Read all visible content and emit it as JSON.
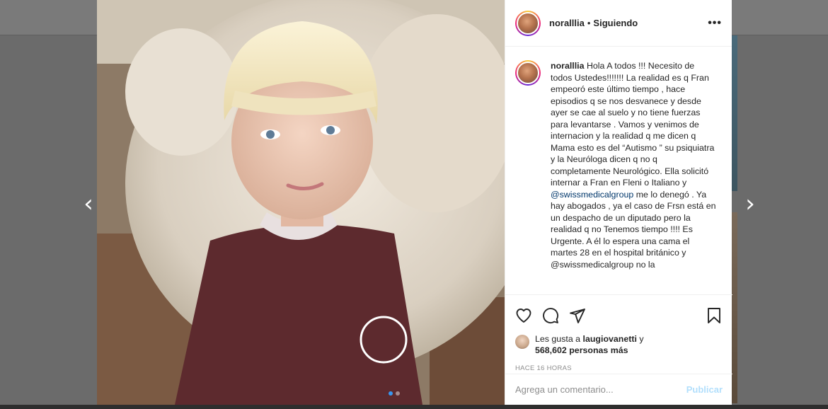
{
  "post": {
    "username": "noralllia",
    "separator": "•",
    "follow_status": "Siguiendo",
    "more_label": "•••",
    "caption_user": "noralllia",
    "caption_part1": "Hola A todos !!! Necesito de todos Ustedes!!!!!!! La realidad es q Fran empeoró este último tiempo , hace episodios q se nos desvanece y desde ayer se cae al suelo y no tiene fuerzas para levantarse . Vamos y venimos de internacion y la realidad q me dicen q Mama esto es del “Autismo ” su psiquiatra y la Neuróloga dicen q no q completamente Neurológico. Ella solicitó internar a Fran en Fleni o Italiano y",
    "mention": "@swissmedicalgroup",
    "caption_part2": "me lo denegó . Ya hay abogados , ya el caso de Frsn está en un despacho de un diputado pero la realidad q no Tenemos tiempo !!!! Es Urgente. A él lo espera una cama el martes 28 en el hospital británico y @swissmedicalgroup no la",
    "likes_prefix": "Les gusta a",
    "likes_user": "laugiovanetti",
    "likes_joiner": "y",
    "likes_count": "568,602 personas más",
    "timestamp": "HACE 16 HORAS",
    "comment_placeholder": "Agrega un comentario...",
    "publish_label": "Publicar"
  },
  "navigation": {
    "prev_arrow": "‹",
    "next_arrow": "›",
    "photo_next": "›"
  },
  "icons": {
    "like": "heart-icon",
    "comment": "comment-icon",
    "share": "share-icon",
    "save": "bookmark-icon"
  },
  "carousel": {
    "total": 2,
    "active": 1
  },
  "colors": {
    "link": "#00376b",
    "publish_disabled": "#b2dffc",
    "carousel_active": "#3897f0",
    "muted_text": "#8e8e8e"
  }
}
